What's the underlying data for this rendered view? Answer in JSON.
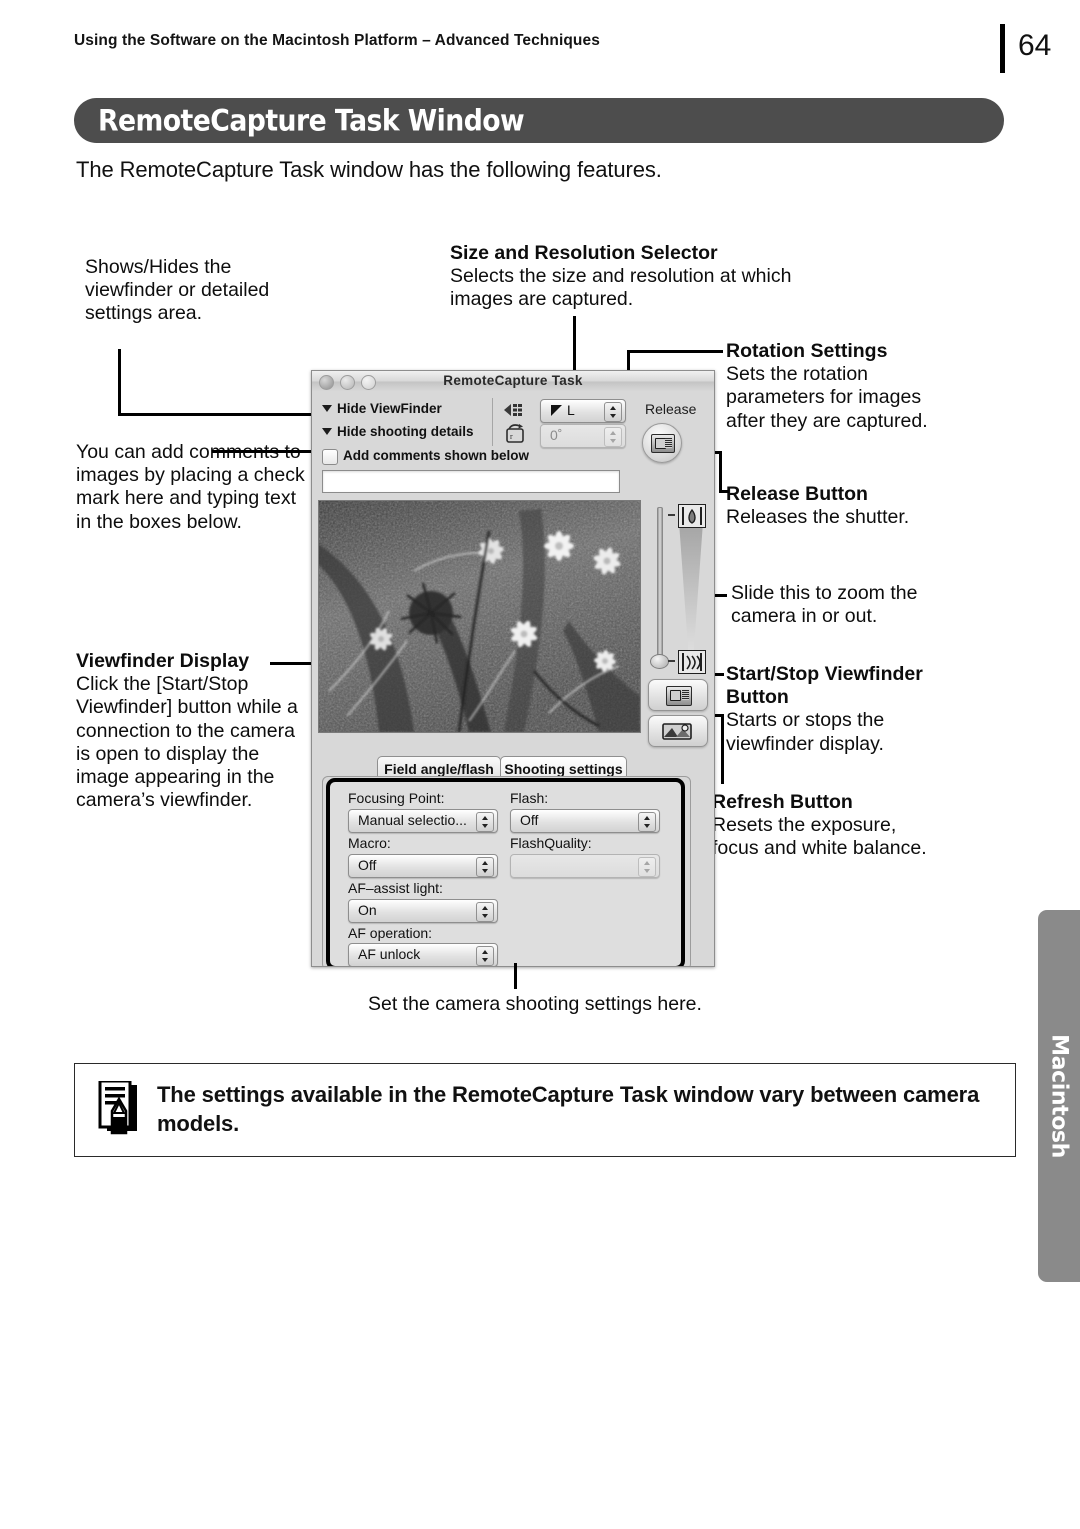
{
  "header": {
    "running_head": "Using the Software on the Macintosh Platform – Advanced Techniques",
    "page_number": "64"
  },
  "title_bar": {
    "title": "RemoteCapture Task Window"
  },
  "intro": "The RemoteCapture Task window has the following features.",
  "annotations": {
    "shows_hides": "Shows/Hides the viewfinder or detailed settings area.",
    "add_comments": "You can add comments to images by placing a check mark here and typing text in the boxes below.",
    "viewfinder_display": {
      "heading": "Viewfinder Display",
      "body": "Click the [Start/Stop Viewfinder] button while a connection to the camera is open to display the image appearing in the camera’s viewfinder."
    },
    "size_resolution": {
      "heading": "Size and Resolution Selector",
      "body": "Selects the size and resolution at which images are captured."
    },
    "rotation_settings": {
      "heading": "Rotation Settings",
      "body": "Sets the rotation parameters for images after they are captured."
    },
    "release_button": {
      "heading": "Release Button",
      "body": "Releases the shutter."
    },
    "zoom_slider": "Slide this to zoom the camera in or out.",
    "start_stop_viewfinder": {
      "heading": "Start/Stop Viewfinder Button",
      "body": "Starts or stops the viewfinder display."
    },
    "refresh_button": {
      "heading": "Refresh Button",
      "body": "Resets the exposure, focus and white balance."
    },
    "caption_bottom": "Set the camera shooting settings here."
  },
  "window": {
    "title": "RemoteCapture Task",
    "disclosure": {
      "hide_viewfinder": "Hide ViewFinder",
      "hide_shooting_details": "Hide shooting details"
    },
    "size_selector_value": "L",
    "rotation_value": "0˚",
    "comments_checkbox_label": "Add comments shown below",
    "comments_field_value": "",
    "release_label": "Release",
    "tabs": [
      {
        "label": "Field angle/flash",
        "active": false
      },
      {
        "label": "Shooting settings",
        "active": true
      }
    ],
    "settings": {
      "left_column": [
        {
          "label": "Focusing Point:",
          "value": "Manual selectio...",
          "enabled": true
        },
        {
          "label": "Macro:",
          "value": "Off",
          "enabled": true
        },
        {
          "label": "AF–assist light:",
          "value": "On",
          "enabled": true
        },
        {
          "label": "AF operation:",
          "value": "AF unlock",
          "enabled": true
        }
      ],
      "right_column": [
        {
          "label": "Flash:",
          "value": "Off",
          "enabled": true
        },
        {
          "label": "FlashQuality:",
          "value": "",
          "enabled": false
        }
      ]
    }
  },
  "note": {
    "text": "The settings available in the RemoteCapture Task window vary between camera models."
  },
  "side_tab": {
    "label": "Macintosh"
  },
  "colors": {
    "title_bar_bg": "#4d4d4d",
    "side_tab_bg": "#8a8a8a",
    "window_bg": "#d8d8d8"
  }
}
